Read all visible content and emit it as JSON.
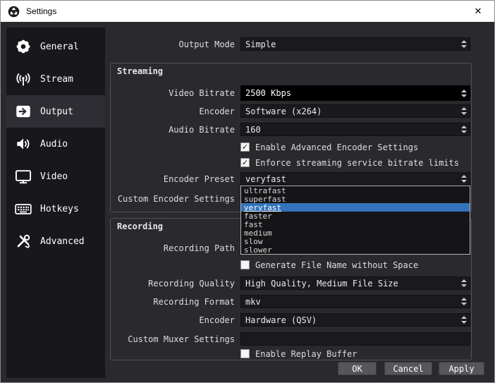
{
  "window": {
    "title": "Settings"
  },
  "icons": {
    "close": "✕",
    "check": "✓"
  },
  "colors": {
    "titlebar_bg": "#ffffff",
    "panel_bg": "#2a2a2e",
    "sidebar_bg": "#18181c",
    "sidebar_selected_bg": "#2d2d33",
    "field_bg": "#1a1a1e",
    "selection_blue": "#3273bb",
    "button_bg": "#56565c"
  },
  "sidebar": {
    "items": [
      {
        "label": "General",
        "icon": "gear-icon",
        "selected": false
      },
      {
        "label": "Stream",
        "icon": "broadcast-icon",
        "selected": false
      },
      {
        "label": "Output",
        "icon": "output-arrow-icon",
        "selected": true
      },
      {
        "label": "Audio",
        "icon": "speaker-icon",
        "selected": false
      },
      {
        "label": "Video",
        "icon": "monitor-icon",
        "selected": false
      },
      {
        "label": "Hotkeys",
        "icon": "keyboard-icon",
        "selected": false
      },
      {
        "label": "Advanced",
        "icon": "tools-icon",
        "selected": false
      }
    ]
  },
  "output_mode": {
    "label": "Output Mode",
    "value": "Simple"
  },
  "streaming": {
    "title": "Streaming",
    "video_bitrate": {
      "label": "Video Bitrate",
      "value": "2500 Kbps"
    },
    "encoder": {
      "label": "Encoder",
      "value": "Software (x264)"
    },
    "audio_bitrate": {
      "label": "Audio Bitrate",
      "value": "160"
    },
    "enable_advanced": {
      "label": "Enable Advanced Encoder Settings",
      "checked": true
    },
    "enforce_limits": {
      "label": "Enforce streaming service bitrate limits",
      "checked": true
    },
    "encoder_preset": {
      "label": "Encoder Preset",
      "value": "veryfast"
    },
    "custom_encoder_settings": {
      "label": "Custom Encoder Settings"
    }
  },
  "preset_dropdown": {
    "options": [
      "ultrafast",
      "superfast",
      "veryfast",
      "faster",
      "fast",
      "medium",
      "slow",
      "slower"
    ],
    "selected": "veryfast"
  },
  "recording": {
    "title": "Recording",
    "recording_path": {
      "label": "Recording Path"
    },
    "generate_no_space": {
      "label": "Generate File Name without Space",
      "checked": false
    },
    "recording_quality": {
      "label": "Recording Quality",
      "value": "High Quality, Medium File Size"
    },
    "recording_format": {
      "label": "Recording Format",
      "value": "mkv"
    },
    "encoder": {
      "label": "Encoder",
      "value": "Hardware (QSV)"
    },
    "custom_muxer": {
      "label": "Custom Muxer Settings",
      "value": ""
    },
    "enable_replay": {
      "label": "Enable Replay Buffer",
      "checked": false
    }
  },
  "footer": {
    "ok": "OK",
    "cancel": "Cancel",
    "apply": "Apply"
  }
}
